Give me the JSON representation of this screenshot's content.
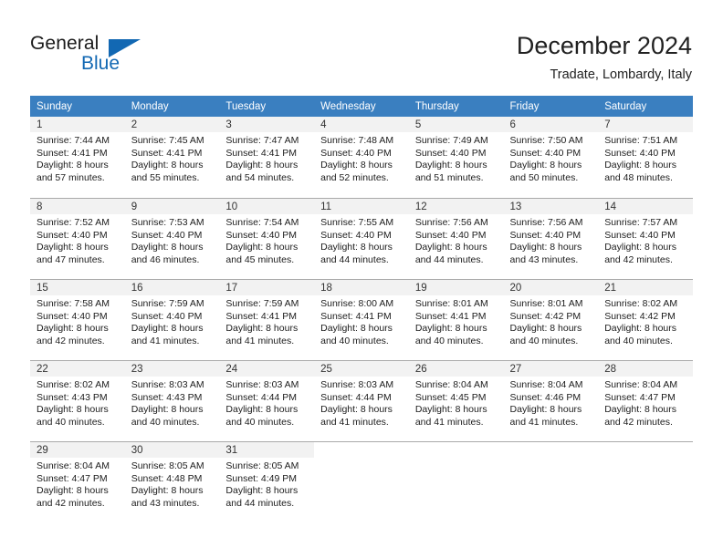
{
  "brand": {
    "name_part1": "General",
    "name_part2": "Blue",
    "accent_color": "#1268b3",
    "logo_icon": "triangle-flag-icon"
  },
  "header": {
    "month_title": "December 2024",
    "location": "Tradate, Lombardy, Italy"
  },
  "calendar": {
    "header_background": "#3a7fc0",
    "weekday_headers": [
      "Sunday",
      "Monday",
      "Tuesday",
      "Wednesday",
      "Thursday",
      "Friday",
      "Saturday"
    ],
    "weeks": [
      [
        {
          "day": "1",
          "sunrise": "Sunrise: 7:44 AM",
          "sunset": "Sunset: 4:41 PM",
          "daylight1": "Daylight: 8 hours",
          "daylight2": "and 57 minutes."
        },
        {
          "day": "2",
          "sunrise": "Sunrise: 7:45 AM",
          "sunset": "Sunset: 4:41 PM",
          "daylight1": "Daylight: 8 hours",
          "daylight2": "and 55 minutes."
        },
        {
          "day": "3",
          "sunrise": "Sunrise: 7:47 AM",
          "sunset": "Sunset: 4:41 PM",
          "daylight1": "Daylight: 8 hours",
          "daylight2": "and 54 minutes."
        },
        {
          "day": "4",
          "sunrise": "Sunrise: 7:48 AM",
          "sunset": "Sunset: 4:40 PM",
          "daylight1": "Daylight: 8 hours",
          "daylight2": "and 52 minutes."
        },
        {
          "day": "5",
          "sunrise": "Sunrise: 7:49 AM",
          "sunset": "Sunset: 4:40 PM",
          "daylight1": "Daylight: 8 hours",
          "daylight2": "and 51 minutes."
        },
        {
          "day": "6",
          "sunrise": "Sunrise: 7:50 AM",
          "sunset": "Sunset: 4:40 PM",
          "daylight1": "Daylight: 8 hours",
          "daylight2": "and 50 minutes."
        },
        {
          "day": "7",
          "sunrise": "Sunrise: 7:51 AM",
          "sunset": "Sunset: 4:40 PM",
          "daylight1": "Daylight: 8 hours",
          "daylight2": "and 48 minutes."
        }
      ],
      [
        {
          "day": "8",
          "sunrise": "Sunrise: 7:52 AM",
          "sunset": "Sunset: 4:40 PM",
          "daylight1": "Daylight: 8 hours",
          "daylight2": "and 47 minutes."
        },
        {
          "day": "9",
          "sunrise": "Sunrise: 7:53 AM",
          "sunset": "Sunset: 4:40 PM",
          "daylight1": "Daylight: 8 hours",
          "daylight2": "and 46 minutes."
        },
        {
          "day": "10",
          "sunrise": "Sunrise: 7:54 AM",
          "sunset": "Sunset: 4:40 PM",
          "daylight1": "Daylight: 8 hours",
          "daylight2": "and 45 minutes."
        },
        {
          "day": "11",
          "sunrise": "Sunrise: 7:55 AM",
          "sunset": "Sunset: 4:40 PM",
          "daylight1": "Daylight: 8 hours",
          "daylight2": "and 44 minutes."
        },
        {
          "day": "12",
          "sunrise": "Sunrise: 7:56 AM",
          "sunset": "Sunset: 4:40 PM",
          "daylight1": "Daylight: 8 hours",
          "daylight2": "and 44 minutes."
        },
        {
          "day": "13",
          "sunrise": "Sunrise: 7:56 AM",
          "sunset": "Sunset: 4:40 PM",
          "daylight1": "Daylight: 8 hours",
          "daylight2": "and 43 minutes."
        },
        {
          "day": "14",
          "sunrise": "Sunrise: 7:57 AM",
          "sunset": "Sunset: 4:40 PM",
          "daylight1": "Daylight: 8 hours",
          "daylight2": "and 42 minutes."
        }
      ],
      [
        {
          "day": "15",
          "sunrise": "Sunrise: 7:58 AM",
          "sunset": "Sunset: 4:40 PM",
          "daylight1": "Daylight: 8 hours",
          "daylight2": "and 42 minutes."
        },
        {
          "day": "16",
          "sunrise": "Sunrise: 7:59 AM",
          "sunset": "Sunset: 4:40 PM",
          "daylight1": "Daylight: 8 hours",
          "daylight2": "and 41 minutes."
        },
        {
          "day": "17",
          "sunrise": "Sunrise: 7:59 AM",
          "sunset": "Sunset: 4:41 PM",
          "daylight1": "Daylight: 8 hours",
          "daylight2": "and 41 minutes."
        },
        {
          "day": "18",
          "sunrise": "Sunrise: 8:00 AM",
          "sunset": "Sunset: 4:41 PM",
          "daylight1": "Daylight: 8 hours",
          "daylight2": "and 40 minutes."
        },
        {
          "day": "19",
          "sunrise": "Sunrise: 8:01 AM",
          "sunset": "Sunset: 4:41 PM",
          "daylight1": "Daylight: 8 hours",
          "daylight2": "and 40 minutes."
        },
        {
          "day": "20",
          "sunrise": "Sunrise: 8:01 AM",
          "sunset": "Sunset: 4:42 PM",
          "daylight1": "Daylight: 8 hours",
          "daylight2": "and 40 minutes."
        },
        {
          "day": "21",
          "sunrise": "Sunrise: 8:02 AM",
          "sunset": "Sunset: 4:42 PM",
          "daylight1": "Daylight: 8 hours",
          "daylight2": "and 40 minutes."
        }
      ],
      [
        {
          "day": "22",
          "sunrise": "Sunrise: 8:02 AM",
          "sunset": "Sunset: 4:43 PM",
          "daylight1": "Daylight: 8 hours",
          "daylight2": "and 40 minutes."
        },
        {
          "day": "23",
          "sunrise": "Sunrise: 8:03 AM",
          "sunset": "Sunset: 4:43 PM",
          "daylight1": "Daylight: 8 hours",
          "daylight2": "and 40 minutes."
        },
        {
          "day": "24",
          "sunrise": "Sunrise: 8:03 AM",
          "sunset": "Sunset: 4:44 PM",
          "daylight1": "Daylight: 8 hours",
          "daylight2": "and 40 minutes."
        },
        {
          "day": "25",
          "sunrise": "Sunrise: 8:03 AM",
          "sunset": "Sunset: 4:44 PM",
          "daylight1": "Daylight: 8 hours",
          "daylight2": "and 41 minutes."
        },
        {
          "day": "26",
          "sunrise": "Sunrise: 8:04 AM",
          "sunset": "Sunset: 4:45 PM",
          "daylight1": "Daylight: 8 hours",
          "daylight2": "and 41 minutes."
        },
        {
          "day": "27",
          "sunrise": "Sunrise: 8:04 AM",
          "sunset": "Sunset: 4:46 PM",
          "daylight1": "Daylight: 8 hours",
          "daylight2": "and 41 minutes."
        },
        {
          "day": "28",
          "sunrise": "Sunrise: 8:04 AM",
          "sunset": "Sunset: 4:47 PM",
          "daylight1": "Daylight: 8 hours",
          "daylight2": "and 42 minutes."
        }
      ],
      [
        {
          "day": "29",
          "sunrise": "Sunrise: 8:04 AM",
          "sunset": "Sunset: 4:47 PM",
          "daylight1": "Daylight: 8 hours",
          "daylight2": "and 42 minutes."
        },
        {
          "day": "30",
          "sunrise": "Sunrise: 8:05 AM",
          "sunset": "Sunset: 4:48 PM",
          "daylight1": "Daylight: 8 hours",
          "daylight2": "and 43 minutes."
        },
        {
          "day": "31",
          "sunrise": "Sunrise: 8:05 AM",
          "sunset": "Sunset: 4:49 PM",
          "daylight1": "Daylight: 8 hours",
          "daylight2": "and 44 minutes."
        },
        null,
        null,
        null,
        null
      ]
    ]
  }
}
